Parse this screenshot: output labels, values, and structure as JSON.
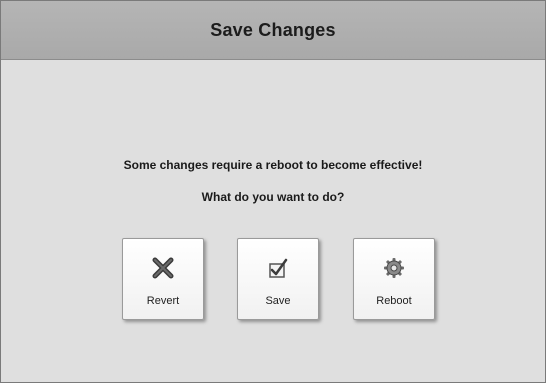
{
  "dialog": {
    "title": "Save Changes",
    "message_line1": "Some changes require a reboot to become effective!",
    "message_line2": "What do you want to do?"
  },
  "buttons": [
    {
      "label": "Revert",
      "icon": "x-icon"
    },
    {
      "label": "Save",
      "icon": "checkbox-icon"
    },
    {
      "label": "Reboot",
      "icon": "gear-icon"
    }
  ],
  "colors": {
    "titlebar": "#b0b0b0",
    "background": "#dfdfdf",
    "button_face": "#f8f8f8",
    "text": "#1c1c1c"
  }
}
